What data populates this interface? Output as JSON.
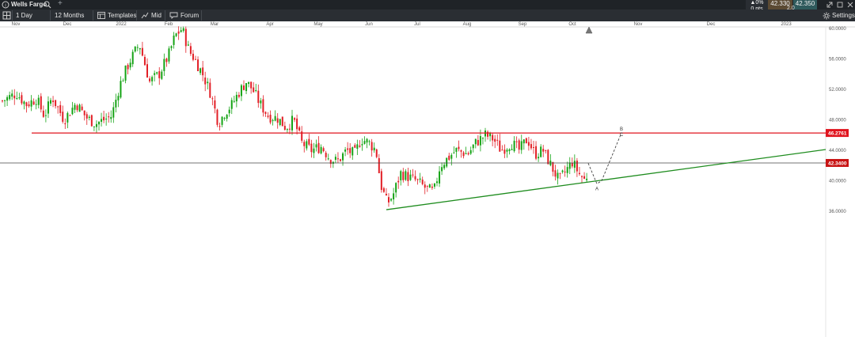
{
  "header": {
    "instrument": "Wells Fargo",
    "add_tab": "+",
    "change_pct": "▲0%",
    "change_pts": "0 pts",
    "sell_price": "42.330",
    "buy_price": "42.350",
    "spread": "2.0"
  },
  "toolbar": {
    "interval": "1 Day",
    "range": "12 Months",
    "templates": "Templates",
    "price_type": "Mid",
    "forum": "Forum",
    "settings": "Settings"
  },
  "colors": {
    "up": "#15a315",
    "down": "#e21f26",
    "support_line": "#1e8c1e",
    "resistance_line": "#e0141e",
    "current_price_tag": "#c81414"
  },
  "chart_data": {
    "type": "candlestick",
    "x_axis_labels": [
      "Nov",
      "Dec",
      "2022",
      "Feb",
      "Mar",
      "Apr",
      "May",
      "Jun",
      "Jul",
      "Aug",
      "Sep",
      "Oct",
      "Nov",
      "Dec",
      "2023"
    ],
    "y_axis_labels": [
      "60.0000",
      "56.0000",
      "52.0000",
      "48.0000",
      "44.0000",
      "40.0000",
      "36.0000"
    ],
    "ylim": [
      34.2,
      60.2
    ],
    "grid": false,
    "current_price": 42.34,
    "current_price_label": "42.3400",
    "resistance_level": 46.2761,
    "resistance_label": "46.2761",
    "trendline": {
      "start": [
        "Jun",
        36.2
      ],
      "end": [
        "2023+",
        44.1
      ]
    },
    "wave_labels": [
      "A",
      "B",
      "C"
    ],
    "projection": [
      [
        "Oct",
        42.3
      ],
      [
        "Oct",
        39.6
      ],
      [
        "Oct",
        40.0
      ],
      [
        "Oct",
        46.3
      ]
    ],
    "candles_approx": [
      [
        "Nov",
        50.5
      ],
      [
        "Dec",
        48.5
      ],
      [
        "2022",
        52.0
      ],
      [
        "Jan",
        57.0
      ],
      [
        "Feb",
        59.5
      ],
      [
        "Feb",
        56.5
      ],
      [
        "Mar",
        49.0
      ],
      [
        "Mar",
        51.5
      ],
      [
        "Apr",
        49.0
      ],
      [
        "Apr",
        47.5
      ],
      [
        "May",
        44.0
      ],
      [
        "May",
        43.0
      ],
      [
        "Jun",
        44.5
      ],
      [
        "Jun",
        38.5
      ],
      [
        "Jun",
        37.5
      ],
      [
        "Jul",
        40.5
      ],
      [
        "Jul",
        39.5
      ],
      [
        "Aug",
        43.5
      ],
      [
        "Aug",
        45.0
      ],
      [
        "Sep",
        46.3
      ],
      [
        "Sep",
        44.5
      ],
      [
        "Sep",
        43.5
      ],
      [
        "Oct",
        41.5
      ],
      [
        "Oct",
        40.5
      ],
      [
        "Oct",
        42.3
      ]
    ]
  }
}
